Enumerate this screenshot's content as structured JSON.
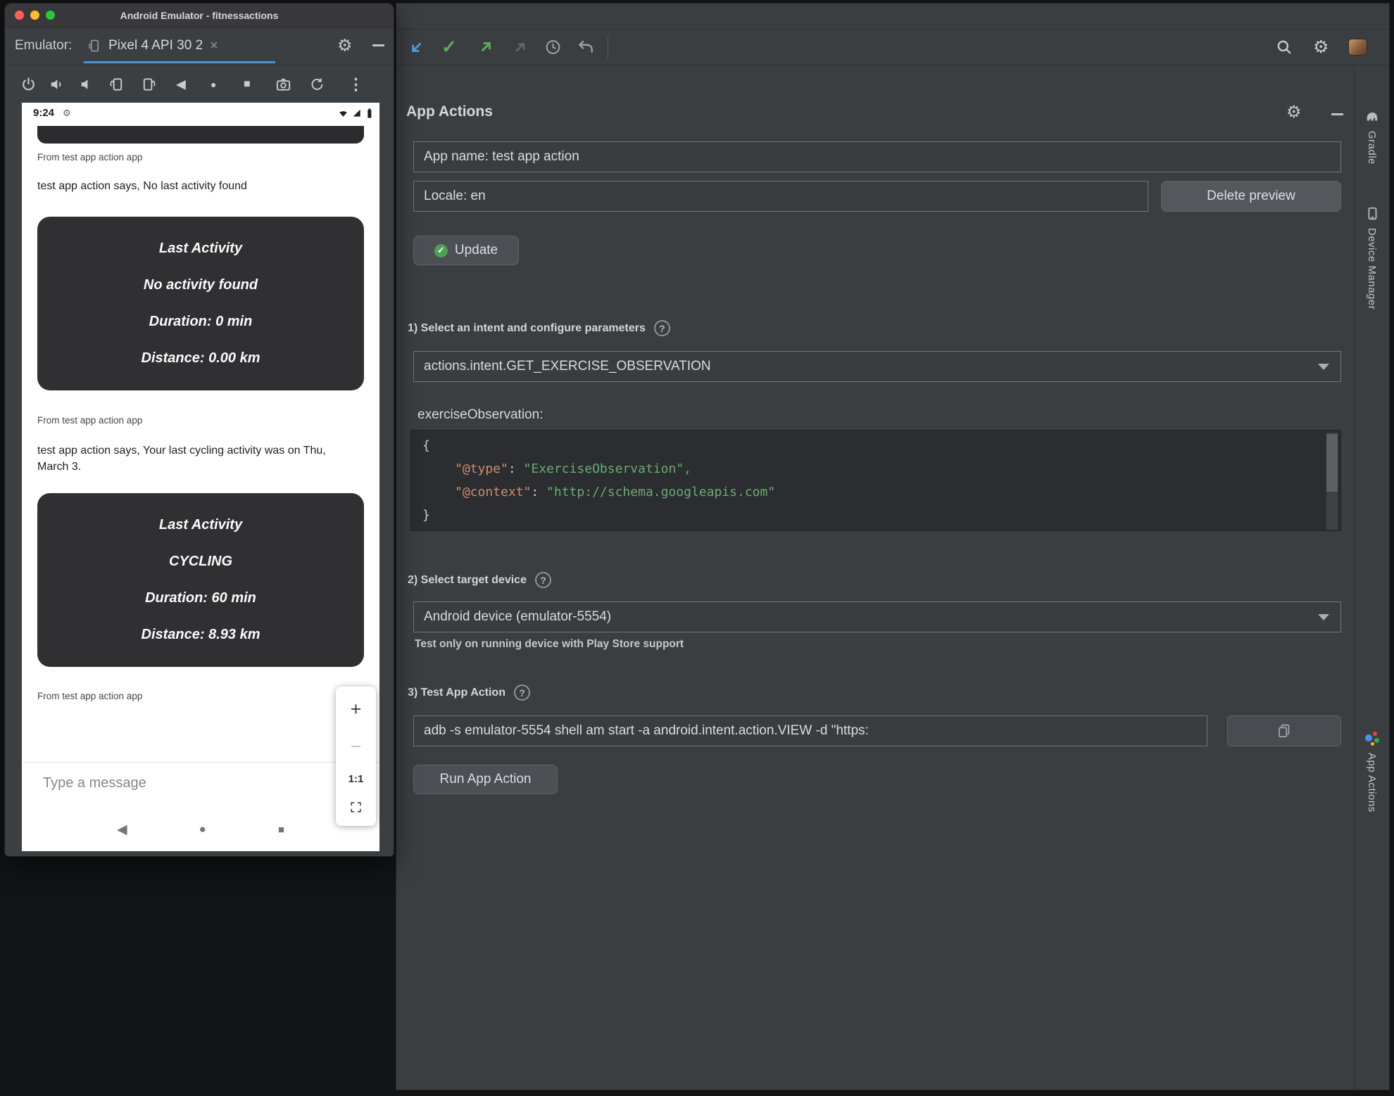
{
  "colors": {
    "accent_blue": "#4a90d9",
    "json_key": "#cf8e6d",
    "json_string": "#6aab73",
    "success_green": "#4f9e58",
    "traffic_red": "#ff5f57",
    "traffic_yellow": "#febc2e",
    "traffic_green": "#28c840"
  },
  "glyphs": {
    "close": "×",
    "gear": "⚙",
    "more_vert": "⋮",
    "back": "◀",
    "home": "●",
    "overview": "■",
    "plus": "+",
    "minus": "−",
    "help": "?",
    "check": "✓"
  },
  "emulator": {
    "title": "Android Emulator - fitnessactions",
    "toolbar": {
      "label": "Emulator:",
      "tab_label": "Pixel 4 API 30 2"
    },
    "phone": {
      "time": "9:24",
      "thread": [
        {
          "from": "From test app action app",
          "text": "test app action says, No last activity found"
        },
        {
          "from": "From test app action app",
          "text": "test app action says, Your last cycling activity was on Thu, March 3."
        },
        {
          "from": "From test app action app"
        }
      ],
      "cards": [
        {
          "title": "Last Activity",
          "activity": "No activity found",
          "duration": "Duration: 0 min",
          "distance": "Distance: 0.00 km"
        },
        {
          "title": "Last Activity",
          "activity": "CYCLING",
          "duration": "Duration: 60 min",
          "distance": "Distance: 8.93 km"
        }
      ],
      "zoom_ratio": "1:1",
      "message_placeholder": "Type a message"
    }
  },
  "studio": {
    "panel_title": "App Actions",
    "app_name_field": "App name: test app action",
    "locale_field": "Locale: en",
    "delete_preview_button": "Delete preview",
    "update_button": "Update",
    "sections": {
      "one": "1) Select an intent and configure parameters",
      "two": "2) Select target device",
      "three": "3) Test App Action"
    },
    "intent_dropdown": "actions.intent.GET_EXERCISE_OBSERVATION",
    "param_name": "exerciseObservation:",
    "code": {
      "open": "{",
      "sep": ": ",
      "type_key": "\"@type\"",
      "type_val": "\"ExerciseObservation\",",
      "context_key": "\"@context\"",
      "context_val": "\"http://schema.googleapis.com\"",
      "close": "}"
    },
    "device_dropdown": "Android device (emulator-5554)",
    "device_hint": "Test only on running device with Play Store support",
    "adb_command": "adb -s emulator-5554 shell am start -a android.intent.action.VIEW -d \"https:",
    "run_button": "Run App Action",
    "sidebar": {
      "gradle": "Gradle",
      "device_manager": "Device Manager",
      "app_actions": "App Actions"
    }
  }
}
